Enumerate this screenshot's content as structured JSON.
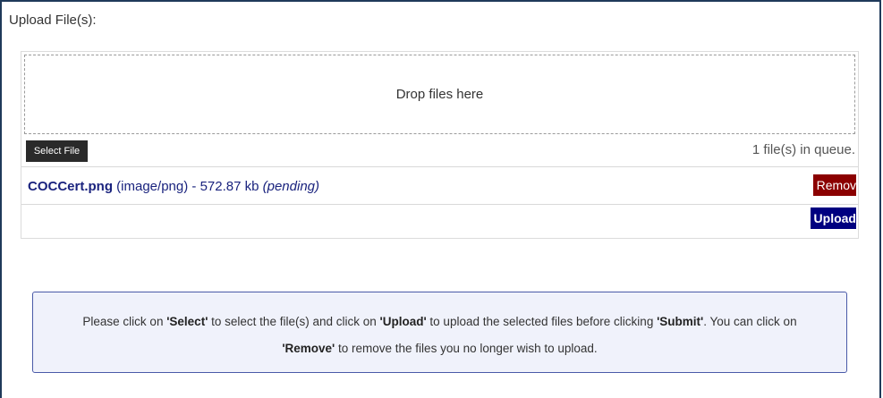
{
  "section_title": "Upload File(s):",
  "dropzone": {
    "label": "Drop files here"
  },
  "toolbar": {
    "select_label": "Select File",
    "queue_count": "1 file(s) in queue."
  },
  "queue": [
    {
      "name": "COCCert.png",
      "type": "(image/png)",
      "separator": "-",
      "size": "572.87 kb",
      "status": "(pending)",
      "remove_label": "Remov"
    }
  ],
  "upload_label": "Upload",
  "notice": {
    "p1": "Please click on ",
    "k1": "'Select'",
    "p2": " to select the file(s) and click on ",
    "k2": "'Upload'",
    "p3": " to upload the selected files before clicking ",
    "k3": "'Submit'",
    "p4": ". You can click on ",
    "k4": "'Remove'",
    "p5": " to remove the files you no longer wish to upload."
  },
  "colors": {
    "frame_border": "#1f3a5a",
    "select_bg": "#2a2a2a",
    "remove_bg": "#8b0000",
    "upload_bg": "#000080",
    "file_text": "#1a237e",
    "notice_border": "#4a5aa8",
    "notice_bg": "#f0f2fb"
  }
}
